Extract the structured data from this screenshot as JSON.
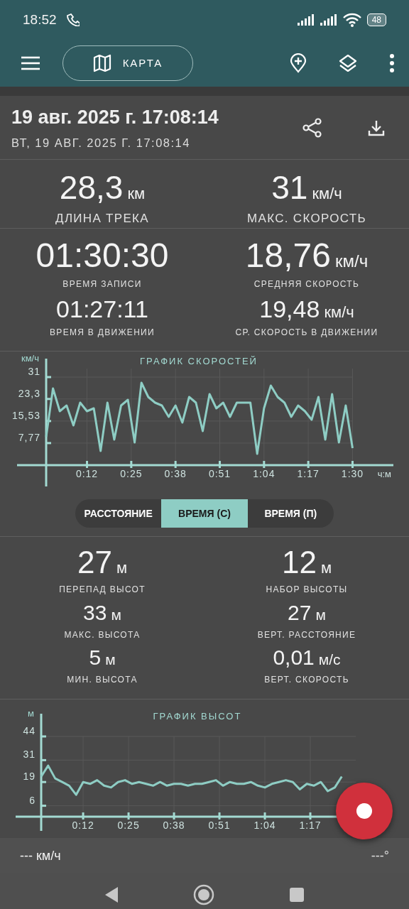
{
  "status_bar": {
    "time": "18:52",
    "battery": "48"
  },
  "toolbar": {
    "map_button": "КАРТА"
  },
  "track": {
    "title": "19 авг. 2025 г. 17:08:14",
    "subtitle": "ВТ, 19 АВГ. 2025 Г. 17:08:14"
  },
  "summary": [
    {
      "value": "28,3",
      "unit": "км",
      "label": "ДЛИНА ТРЕКА"
    },
    {
      "value": "31",
      "unit": "км/ч",
      "label": "МАКС. СКОРОСТЬ"
    }
  ],
  "time_stats": [
    {
      "kind": "primary",
      "cells": [
        {
          "value": "01:30:30",
          "label": "ВРЕМЯ ЗАПИСИ"
        },
        {
          "value": "18,76",
          "unit": "км/ч",
          "label": "СРЕДНЯЯ СКОРОСТЬ"
        }
      ]
    },
    {
      "kind": "secondary",
      "cells": [
        {
          "value": "01:27:11",
          "label": "ВРЕМЯ В ДВИЖЕНИИ"
        },
        {
          "value": "19,48",
          "unit": "км/ч",
          "label": "СР. СКОРОСТЬ В ДВИЖЕНИИ"
        }
      ]
    }
  ],
  "speed_chart": {
    "chart_data": {
      "type": "line",
      "title": "ГРАФИК СКОРОСТЕЙ",
      "ylabel": "км/ч",
      "xlabel": "ч:м",
      "x": [
        0,
        2,
        4,
        6,
        8,
        10,
        12,
        14,
        16,
        18,
        20,
        22,
        24,
        26,
        28,
        30,
        32,
        34,
        36,
        38,
        40,
        42,
        44,
        46,
        48,
        50,
        52,
        54,
        56,
        58,
        60,
        62,
        64,
        66,
        68,
        70,
        72,
        74,
        76,
        78,
        80,
        82,
        84,
        86,
        88,
        90
      ],
      "series": [
        {
          "color": "#8ecdc4",
          "values": [
            10,
            27,
            19,
            21,
            14,
            22,
            19,
            20,
            5,
            22,
            9,
            21,
            23,
            8,
            29,
            24,
            22,
            21,
            17,
            21,
            15,
            24,
            22,
            12,
            25,
            20,
            22,
            17,
            22,
            22,
            22,
            4,
            20,
            28,
            24,
            22,
            17,
            21,
            19,
            16,
            24,
            9,
            25,
            8,
            21,
            6
          ]
        }
      ],
      "xlim": [
        0,
        102
      ],
      "ylim": [
        0,
        34
      ],
      "grid": true,
      "xticks": [
        {
          "value": 12,
          "label": "0:12"
        },
        {
          "value": 25,
          "label": "0:25"
        },
        {
          "value": 38,
          "label": "0:38"
        },
        {
          "value": 51,
          "label": "0:51"
        },
        {
          "value": 64,
          "label": "1:04"
        },
        {
          "value": 77,
          "label": "1:17"
        },
        {
          "value": 90,
          "label": "1:30"
        }
      ],
      "yticks": [
        {
          "value": 7.77,
          "label": "7,77"
        },
        {
          "value": 15.53,
          "label": "15,53"
        },
        {
          "value": 23.3,
          "label": "23,3"
        },
        {
          "value": 31,
          "label": "31"
        }
      ]
    }
  },
  "axis_modes": [
    {
      "label": "РАССТОЯНИЕ",
      "selected": false
    },
    {
      "label": "ВРЕМЯ (С)",
      "selected": true
    },
    {
      "label": "ВРЕМЯ (П)",
      "selected": false
    }
  ],
  "altitude_stats": [
    {
      "kind": "primary",
      "cells": [
        {
          "value": "27",
          "unit": "м",
          "label": "ПЕРЕПАД ВЫСОТ"
        },
        {
          "value": "12",
          "unit": "м",
          "label": "НАБОР ВЫСОТЫ"
        }
      ]
    },
    {
      "kind": "secondary",
      "cells": [
        {
          "value": "33",
          "unit": "м",
          "label": "МАКС. ВЫСОТА"
        },
        {
          "value": "27",
          "unit": "м",
          "label": "ВЕРТ. РАССТОЯНИЕ"
        }
      ]
    },
    {
      "kind": "secondary",
      "cells": [
        {
          "value": "5",
          "unit": "м",
          "label": "МИН. ВЫСОТА"
        },
        {
          "value": "0,01",
          "unit": "м/с",
          "label": "ВЕРТ. СКОРОСТЬ"
        }
      ]
    }
  ],
  "altitude_chart": {
    "chart_data": {
      "type": "line",
      "title": "ГРАФИК ВЫСОТ",
      "ylabel": "м",
      "x": [
        0,
        2,
        4,
        6,
        8,
        10,
        12,
        14,
        16,
        18,
        20,
        22,
        24,
        26,
        28,
        30,
        32,
        34,
        36,
        38,
        40,
        42,
        44,
        46,
        48,
        50,
        52,
        54,
        56,
        58,
        60,
        62,
        64,
        66,
        68,
        70,
        72,
        74,
        76,
        78,
        80,
        82,
        84,
        86
      ],
      "series": [
        {
          "color": "#8ecdc4",
          "values": [
            22,
            28,
            21,
            19,
            17,
            12,
            19,
            18,
            20,
            17,
            16,
            19,
            20,
            18,
            19,
            18,
            17,
            19,
            17,
            18,
            18,
            17,
            18,
            18,
            19,
            20,
            17,
            19,
            18,
            18,
            19,
            17,
            16,
            18,
            19,
            20,
            19,
            15,
            18,
            17,
            19,
            14,
            16,
            22
          ]
        }
      ],
      "xlim": [
        0,
        90
      ],
      "ylim": [
        0,
        44
      ],
      "grid": true,
      "xticks": [
        {
          "value": 12,
          "label": "0:12"
        },
        {
          "value": 25,
          "label": "0:25"
        },
        {
          "value": 38,
          "label": "0:38"
        },
        {
          "value": 51,
          "label": "0:51"
        },
        {
          "value": 64,
          "label": "1:04"
        },
        {
          "value": 77,
          "label": "1:17"
        }
      ],
      "yticks": [
        {
          "value": 6,
          "label": "6"
        },
        {
          "value": 19,
          "label": "19"
        },
        {
          "value": 31,
          "label": "31"
        },
        {
          "value": 44,
          "label": "44"
        }
      ]
    }
  },
  "bottom_bar": {
    "speed": "--- км/ч",
    "heading": "---°"
  }
}
